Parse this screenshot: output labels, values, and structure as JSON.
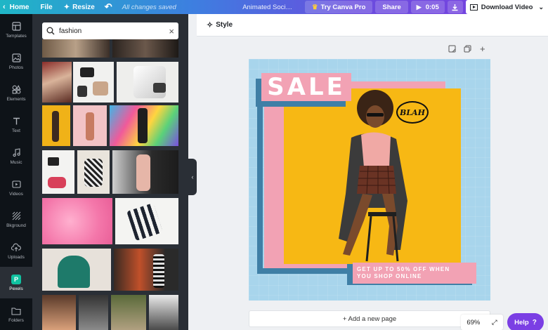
{
  "topbar": {
    "home": "Home",
    "file": "File",
    "resize": "Resize",
    "saved_status": "All changes saved",
    "doc_title": "Animated Soci…",
    "try_pro": "Try Canva Pro",
    "share": "Share",
    "duration": "0:05",
    "download": "Download Video"
  },
  "rail": {
    "items": [
      {
        "label": "Templates",
        "icon": "templates-icon"
      },
      {
        "label": "Photos",
        "icon": "photos-icon"
      },
      {
        "label": "Elements",
        "icon": "elements-icon"
      },
      {
        "label": "Text",
        "icon": "text-icon"
      },
      {
        "label": "Music",
        "icon": "music-icon"
      },
      {
        "label": "Videos",
        "icon": "videos-icon"
      },
      {
        "label": "Bkground",
        "icon": "background-icon"
      },
      {
        "label": "Uploads",
        "icon": "uploads-icon"
      },
      {
        "label": "Pexels",
        "icon": "pexels-icon"
      },
      {
        "label": "Folders",
        "icon": "folders-icon"
      }
    ],
    "active": "Pexels",
    "pexels_glyph": "P"
  },
  "search": {
    "value": "fashion"
  },
  "editor": {
    "style_label": "Style"
  },
  "design": {
    "sale_text": "SALE",
    "speech_bubble": "BLAH",
    "cta_line1": "GET UP TO 50% OFF WHEN",
    "cta_line2": "YOU SHOP ONLINE"
  },
  "footer": {
    "add_page": "+ Add a new page",
    "zoom": "69%",
    "help": "Help",
    "help_glyph": "?"
  },
  "colors": {
    "accent_purple": "#7b3fe4",
    "canvas_blue": "#a8d5ec",
    "pink": "#f2a2b4",
    "yellow": "#f7b814",
    "shadow_blue": "#3f7fa6"
  }
}
